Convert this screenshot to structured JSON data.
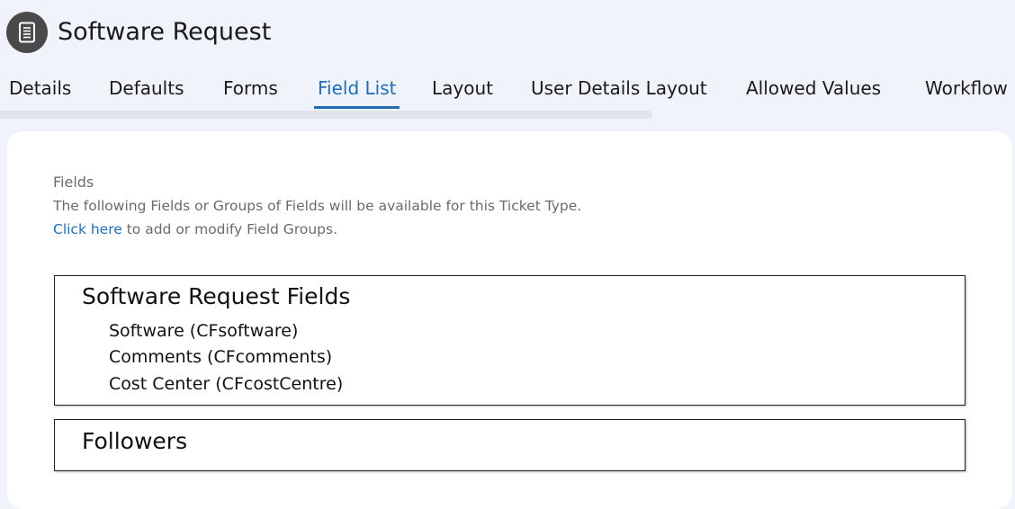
{
  "header": {
    "icon": "list-document-icon",
    "title": "Software Request"
  },
  "tabs": [
    {
      "label": "Details",
      "active": false
    },
    {
      "label": "Defaults",
      "active": false
    },
    {
      "label": "Forms",
      "active": false
    },
    {
      "label": "Field List",
      "active": true
    },
    {
      "label": "Layout",
      "active": false
    },
    {
      "label": "User Details Layout",
      "active": false
    },
    {
      "label": "Allowed Values",
      "active": false
    },
    {
      "label": "Workflow",
      "active": false
    }
  ],
  "fields_section": {
    "heading": "Fields",
    "description": "The following Fields or Groups of Fields will be available for this Ticket Type.",
    "link_text": "Click here",
    "link_suffix": " to add or modify Field Groups."
  },
  "groups": [
    {
      "title": "Software Request Fields",
      "fields": [
        "Software (CFsoftware)",
        "Comments (CFcomments)",
        "Cost Center (CFcostCentre)"
      ]
    },
    {
      "title": "Followers",
      "fields": []
    }
  ],
  "colors": {
    "accent": "#1f6db4",
    "page_bg": "#f0f3fa",
    "card_bg": "#ffffff",
    "icon_bg": "#4a4a4a"
  }
}
